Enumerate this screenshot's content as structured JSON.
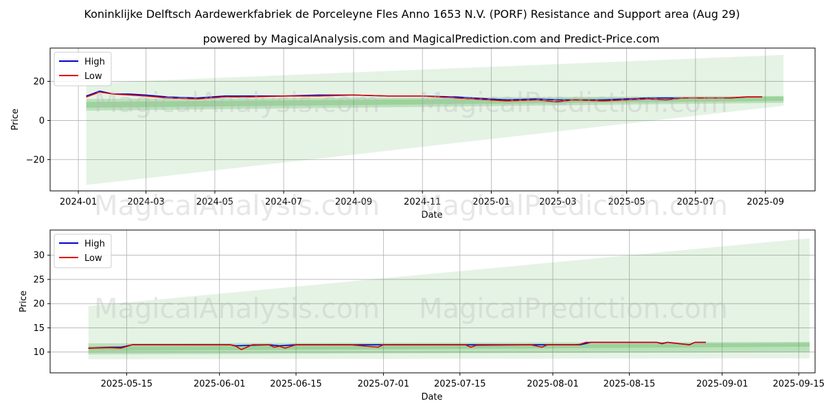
{
  "title": "Koninklijke Delftsch Aardewerkfabriek de Porceleyne Fles Anno 1653 N.V. (PORF) Resistance and Support area (Aug 29)",
  "subtitle": "powered by MagicalAnalysis.com and MagicalPrediction.com and Predict-Price.com",
  "watermarks": [
    "MagicalAnalysis.com",
    "MagicalPrediction.com"
  ],
  "colors": {
    "high": "#0000cc",
    "low": "#dd0000",
    "band": "#2ca02c"
  },
  "chart_data": [
    {
      "type": "line",
      "xlabel": "Date",
      "ylabel": "Price",
      "x_ticks": [
        "2024-01",
        "2024-03",
        "2024-05",
        "2024-07",
        "2024-09",
        "2024-11",
        "2025-01",
        "2025-03",
        "2025-05",
        "2025-07",
        "2025-09"
      ],
      "y_ticks": [
        "20",
        "0",
        "−20"
      ],
      "ylim": [
        -36,
        37
      ],
      "xlim": [
        "2023-12-07",
        "2025-10-15"
      ],
      "legend": {
        "position": "top-left",
        "entries": [
          "High",
          "Low"
        ]
      },
      "grid": true,
      "series": [
        {
          "name": "High",
          "x": [
            "2024-01-08",
            "2024-01-20",
            "2024-02-01",
            "2024-02-15",
            "2024-03-01",
            "2024-03-20",
            "2024-04-15",
            "2024-05-10",
            "2024-06-01",
            "2024-07-01",
            "2024-08-01",
            "2024-09-01",
            "2024-10-01",
            "2024-11-01",
            "2024-12-01",
            "2024-12-30",
            "2025-01-15",
            "2025-02-10",
            "2025-02-28",
            "2025-03-15",
            "2025-04-10",
            "2025-05-01",
            "2025-05-20",
            "2025-06-05",
            "2025-06-20",
            "2025-07-15",
            "2025-08-01",
            "2025-08-15",
            "2025-08-29"
          ],
          "values": [
            12.5,
            15,
            13.5,
            13.5,
            13,
            12,
            11.5,
            12.5,
            12.5,
            12.5,
            13,
            13,
            12.5,
            12.5,
            12,
            11,
            10.5,
            11,
            10.5,
            10.5,
            10.5,
            11,
            11.5,
            11.5,
            11.5,
            11.5,
            11.5,
            12,
            12
          ]
        },
        {
          "name": "Low",
          "x": [
            "2024-01-08",
            "2024-01-20",
            "2024-02-01",
            "2024-02-15",
            "2024-03-01",
            "2024-03-20",
            "2024-04-15",
            "2024-05-10",
            "2024-06-01",
            "2024-07-01",
            "2024-08-01",
            "2024-09-01",
            "2024-10-01",
            "2024-11-01",
            "2024-12-01",
            "2024-12-30",
            "2025-01-15",
            "2025-02-10",
            "2025-02-28",
            "2025-03-15",
            "2025-04-10",
            "2025-05-01",
            "2025-05-20",
            "2025-06-05",
            "2025-06-20",
            "2025-07-15",
            "2025-08-01",
            "2025-08-15",
            "2025-08-29"
          ],
          "values": [
            12,
            14.5,
            13.5,
            13,
            12.5,
            11.5,
            11,
            12,
            12,
            12.5,
            12.5,
            13,
            12.5,
            12.5,
            11.5,
            10.5,
            10,
            10.5,
            9.5,
            10.5,
            10,
            10.5,
            11,
            10.5,
            11.5,
            11.5,
            11.5,
            12,
            12
          ]
        }
      ],
      "bands": [
        {
          "x": [
            "2024-01-08",
            "2025-09-17"
          ],
          "upper": [
            19,
            33.5
          ],
          "lower": [
            -33,
            7.5
          ]
        },
        {
          "x": [
            "2024-01-08",
            "2025-09-17"
          ],
          "upper": [
            11,
            12.5
          ],
          "lower": [
            5,
            9
          ]
        },
        {
          "x": [
            "2024-01-08",
            "2025-09-17"
          ],
          "upper": [
            9.5,
            12.2
          ],
          "lower": [
            6.5,
            10
          ]
        }
      ]
    },
    {
      "type": "line",
      "xlabel": "Date",
      "ylabel": "Price",
      "x_ticks": [
        "2025-05-15",
        "2025-06-01",
        "2025-06-15",
        "2025-07-01",
        "2025-07-15",
        "2025-08-01",
        "2025-08-15",
        "2025-09-01",
        "2025-09-15"
      ],
      "y_ticks": [
        "30",
        "25",
        "20",
        "15",
        "10"
      ],
      "ylim": [
        5.7,
        35.2
      ],
      "xlim": [
        "2025-05-01",
        "2025-09-18"
      ],
      "legend": {
        "position": "top-left",
        "entries": [
          "High",
          "Low"
        ]
      },
      "grid": true,
      "series": [
        {
          "name": "High",
          "x": [
            "2025-05-08",
            "2025-05-12",
            "2025-05-14",
            "2025-05-16",
            "2025-06-03",
            "2025-06-04",
            "2025-06-10",
            "2025-06-12",
            "2025-06-15",
            "2025-06-28",
            "2025-07-01",
            "2025-07-16",
            "2025-07-18",
            "2025-07-28",
            "2025-07-30",
            "2025-08-01",
            "2025-08-06",
            "2025-08-08",
            "2025-08-20",
            "2025-08-21",
            "2025-08-22",
            "2025-08-26",
            "2025-08-27",
            "2025-08-29"
          ],
          "values": [
            10.8,
            11,
            11,
            11.5,
            11.5,
            11.3,
            11.5,
            11.3,
            11.5,
            11.5,
            11.5,
            11.5,
            11.5,
            11.5,
            11.5,
            11.5,
            11.5,
            12,
            12,
            11.8,
            12,
            11.5,
            12,
            12
          ]
        },
        {
          "name": "Low",
          "x": [
            "2025-05-08",
            "2025-05-12",
            "2025-05-14",
            "2025-05-16",
            "2025-06-03",
            "2025-06-04",
            "2025-06-05",
            "2025-06-07",
            "2025-06-10",
            "2025-06-11",
            "2025-06-12",
            "2025-06-13",
            "2025-06-15",
            "2025-06-25",
            "2025-06-30",
            "2025-07-01",
            "2025-07-16",
            "2025-07-17",
            "2025-07-18",
            "2025-07-28",
            "2025-07-30",
            "2025-07-31",
            "2025-08-01",
            "2025-08-05",
            "2025-08-06",
            "2025-08-07",
            "2025-08-20",
            "2025-08-21",
            "2025-08-22",
            "2025-08-26",
            "2025-08-27",
            "2025-08-29"
          ],
          "values": [
            10.8,
            10.9,
            10.8,
            11.5,
            11.5,
            11.2,
            10.5,
            11.5,
            11.5,
            11,
            11.2,
            10.8,
            11.5,
            11.5,
            11,
            11.5,
            11.5,
            11,
            11.4,
            11.5,
            11,
            11.5,
            11.5,
            11.5,
            11.6,
            12,
            12,
            11.7,
            12,
            11.5,
            12,
            12
          ]
        }
      ],
      "bands": [
        {
          "x": [
            "2025-05-08",
            "2025-09-17"
          ],
          "upper": [
            19.5,
            33.5
          ],
          "lower": [
            8.5,
            8.7
          ]
        },
        {
          "x": [
            "2025-05-08",
            "2025-09-17"
          ],
          "upper": [
            11.8,
            12.1
          ],
          "lower": [
            9.5,
            10
          ]
        },
        {
          "x": [
            "2025-05-08",
            "2025-09-17"
          ],
          "upper": [
            11.2,
            11.9
          ],
          "lower": [
            10.2,
            11.1
          ]
        }
      ]
    }
  ]
}
